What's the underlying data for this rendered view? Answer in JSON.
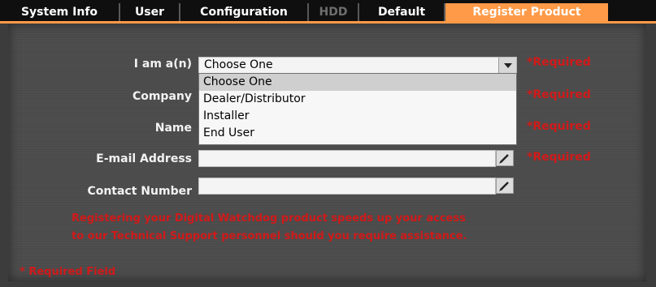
{
  "tabs": [
    {
      "label": "System Info",
      "state": "normal"
    },
    {
      "label": "User",
      "state": "normal"
    },
    {
      "label": "Configuration",
      "state": "normal"
    },
    {
      "label": "HDD",
      "state": "disabled"
    },
    {
      "label": "Default",
      "state": "normal"
    },
    {
      "label": "Register Product",
      "state": "active"
    }
  ],
  "form": {
    "role": {
      "label": "I am a(n)",
      "value": "Choose One",
      "required": "*Required"
    },
    "company": {
      "label": "Company",
      "value": "",
      "required": "*Required"
    },
    "name": {
      "label": "Name",
      "value": "",
      "required": "*Required"
    },
    "email": {
      "label": "E-mail Address",
      "value": "",
      "required": "*Required"
    },
    "contact": {
      "label": "Contact Number",
      "value": ""
    }
  },
  "dropdown": {
    "options": [
      "Choose One",
      "Dealer/Distributor",
      "Installer",
      "End User"
    ],
    "selected": "Choose One"
  },
  "note": {
    "line1": "Registering your Digital Watchdog product speeds up your access",
    "line2": "to our Technical Support personnel should you require assistance."
  },
  "footer": {
    "required_field": "* Required Field"
  },
  "colors": {
    "accent": "#ff9a48",
    "required": "#d11a1a"
  },
  "icons": {
    "dropdown": "triangle-down",
    "edit": "pencil"
  }
}
